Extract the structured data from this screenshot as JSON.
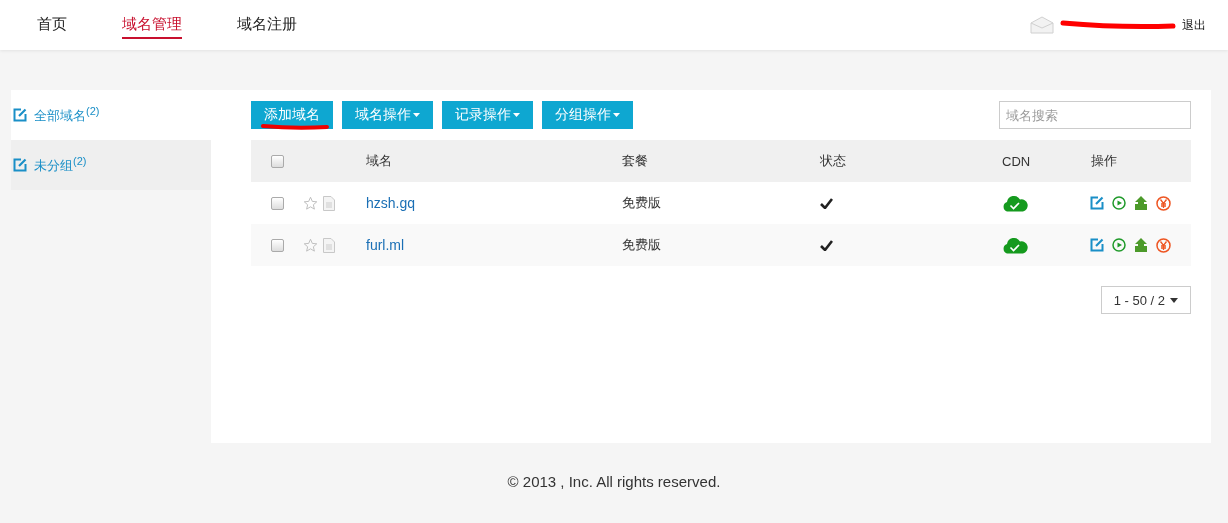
{
  "nav": {
    "tabs": [
      {
        "label": "首页",
        "selected": false
      },
      {
        "label": "域名管理",
        "selected": true
      },
      {
        "label": "域名注册",
        "selected": false
      }
    ],
    "logout": "退出"
  },
  "sidebar": {
    "items": [
      {
        "label": "全部域名",
        "count": "(2)",
        "selected": true
      },
      {
        "label": "未分组",
        "count": "(2)",
        "selected": false
      }
    ]
  },
  "toolbar": {
    "buttons": [
      {
        "label": "添加域名",
        "dropdown": false
      },
      {
        "label": "域名操作",
        "dropdown": true
      },
      {
        "label": "记录操作",
        "dropdown": true
      },
      {
        "label": "分组操作",
        "dropdown": true
      }
    ],
    "search": {
      "placeholder": "域名搜索"
    }
  },
  "table": {
    "select_all_checked": false,
    "columns": [
      "域名",
      "套餐",
      "状态",
      "CDN",
      "操作"
    ],
    "rows": [
      {
        "checked": false,
        "starred": false,
        "domain": "hzsh.gq",
        "plan": "免费版",
        "status_ok": true,
        "cdn_on": true
      },
      {
        "checked": false,
        "starred": false,
        "domain": "furl.ml",
        "plan": "免费版",
        "status_ok": true,
        "cdn_on": true
      }
    ]
  },
  "pagination": {
    "label": "1 - 50 / 2"
  },
  "footer": "© 2013 , Inc. All rights reserved."
}
